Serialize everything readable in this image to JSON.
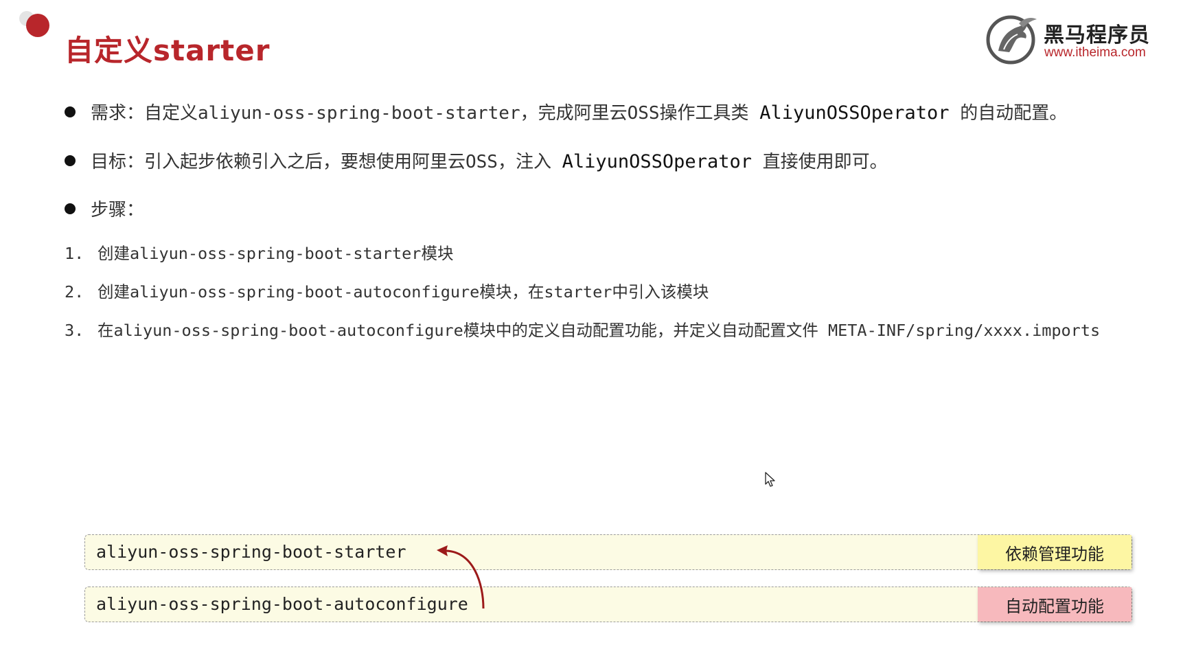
{
  "header": {
    "title": "自定义starter",
    "logo_cn": "黑马程序员",
    "logo_url": "www.itheima.com"
  },
  "bullets": [
    {
      "prefix": "需求：自定义aliyun-oss-spring-boot-starter，完成阿里云OSS操作工具类 ",
      "code": "AliyunOSSOperator",
      "suffix": " 的自动配置。"
    },
    {
      "prefix": "目标：引入起步依赖引入之后，要想使用阿里云OSS，注入 ",
      "code": "AliyunOSSOperator",
      "suffix": " 直接使用即可。"
    },
    {
      "prefix": "步骤：",
      "code": "",
      "suffix": ""
    }
  ],
  "steps": [
    {
      "num": "1.",
      "text": "创建aliyun-oss-spring-boot-starter模块"
    },
    {
      "num": "2.",
      "text": "创建aliyun-oss-spring-boot-autoconfigure模块，在starter中引入该模块"
    },
    {
      "num": "3.",
      "text": "在aliyun-oss-spring-boot-autoconfigure模块中的定义自动配置功能，并定义自动配置文件 META-INF/spring/xxxx.imports"
    }
  ],
  "modules": [
    {
      "name": "aliyun-oss-spring-boot-starter",
      "tag": "依赖管理功能",
      "tag_color": "#fdf6a3"
    },
    {
      "name": "aliyun-oss-spring-boot-autoconfigure",
      "tag": "自动配置功能",
      "tag_color": "#f7b9bd"
    }
  ],
  "colors": {
    "accent": "#b8262b",
    "module_bg": "#fcfbe4"
  },
  "icons": {
    "logo": "horse-logo-icon",
    "cursor": "mouse-cursor-icon",
    "arrow": "dependency-arrow-icon"
  }
}
